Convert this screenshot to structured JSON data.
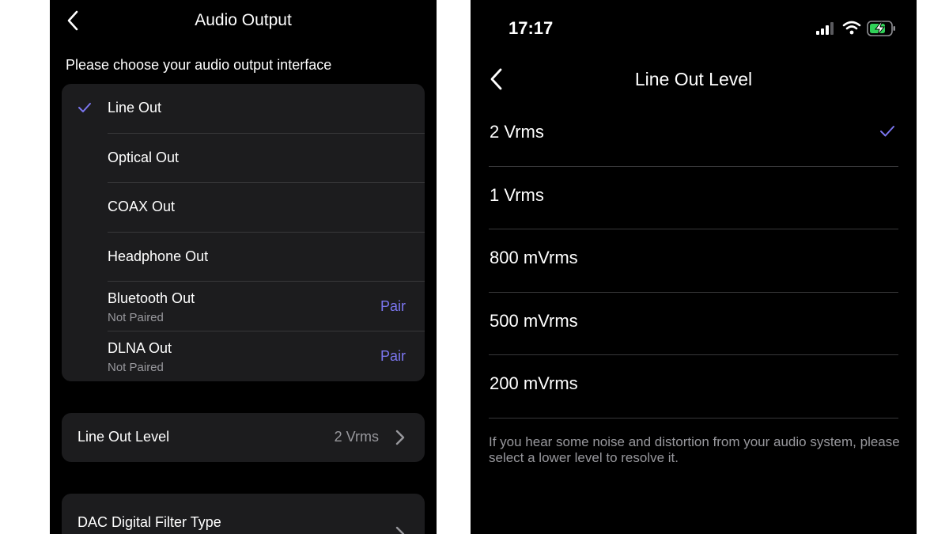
{
  "left_screen": {
    "title": "Audio Output",
    "subtitle": "Please choose your audio output interface",
    "outputs": [
      {
        "label": "Line Out",
        "selected": true
      },
      {
        "label": "Optical Out"
      },
      {
        "label": "COAX Out"
      },
      {
        "label": "Headphone Out"
      },
      {
        "label": "Bluetooth Out",
        "status": "Not Paired",
        "action": "Pair"
      },
      {
        "label": "DLNA Out",
        "status": "Not Paired",
        "action": "Pair"
      }
    ],
    "line_out_level": {
      "label": "Line Out Level",
      "value": "2 Vrms"
    },
    "dac_filter": {
      "label": "DAC Digital Filter Type"
    }
  },
  "right_screen": {
    "status_bar": {
      "time": "17:17",
      "icons": [
        "cellular-signal-icon",
        "wifi-icon",
        "battery-charging-icon"
      ]
    },
    "title": "Line Out Level",
    "levels": [
      {
        "label": "2 Vrms",
        "selected": true
      },
      {
        "label": "1 Vrms"
      },
      {
        "label": "800 mVrms"
      },
      {
        "label": "500 mVrms"
      },
      {
        "label": "200 mVrms"
      }
    ],
    "hint": "If you hear some noise and distortion from your audio system, please select a lower level to resolve it."
  },
  "colors": {
    "background": "#000000",
    "card": "#1c1c1e",
    "separator": "#38383a",
    "accent": "#7b76f0",
    "secondary_text": "#98989d",
    "battery_green": "#30d158"
  }
}
